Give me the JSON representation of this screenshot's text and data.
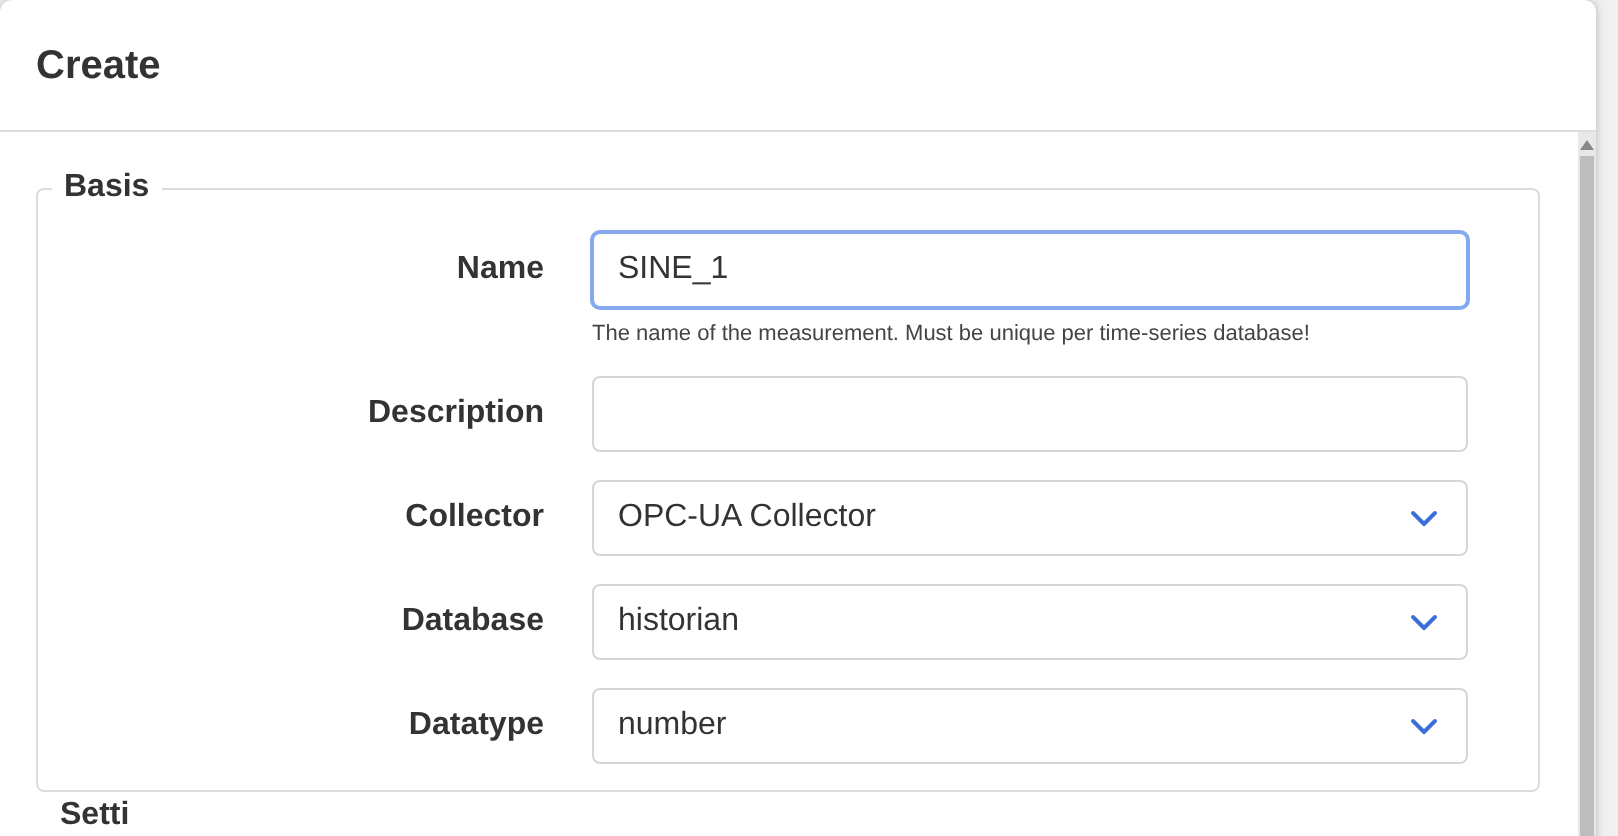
{
  "dialog": {
    "title": "Create"
  },
  "sections": [
    {
      "legend": "Basis",
      "fields": [
        {
          "kind": "text",
          "label": "Name",
          "value": "SINE_1",
          "focused": true,
          "hint": "The name of the measurement. Must be unique per time-series database!"
        },
        {
          "kind": "text",
          "label": "Description",
          "focused": false
        },
        {
          "kind": "select",
          "label": "Collector",
          "value": "OPC-UA Collector",
          "focused": false
        },
        {
          "kind": "select",
          "label": "Database",
          "value": "historian",
          "focused": false
        },
        {
          "kind": "select",
          "label": "Datatype",
          "value": "number",
          "focused": false
        }
      ]
    },
    {
      "legend": "Setti"
    }
  ]
}
